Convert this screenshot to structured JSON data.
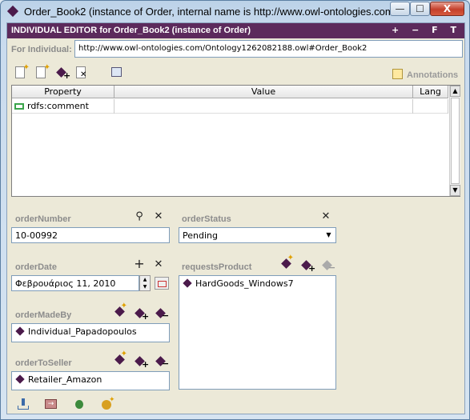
{
  "window": {
    "title": "Order_Book2   (instance of Order, internal name is http://www.owl-ontologies.com/",
    "min_label": "—",
    "max_label": "☐",
    "close_label": "X"
  },
  "editor": {
    "header_label": "INDIVIDUAL EDITOR for Order_Book2   (instance of Order)",
    "header_actions": "+ − F T",
    "for_individual_label": "For Individual:",
    "for_individual_value": "http://www.owl-ontologies.com/Ontology1262082188.owl#Order_Book2",
    "annotations_label": "Annotations"
  },
  "properties_table": {
    "columns": [
      "Property",
      "Value",
      "Lang"
    ],
    "rows": [
      {
        "property": "rdfs:comment",
        "value": "",
        "lang": ""
      }
    ]
  },
  "fields": {
    "order_number": {
      "label": "orderNumber",
      "value": "10-00992"
    },
    "order_status": {
      "label": "orderStatus",
      "value": "Pending"
    },
    "order_date": {
      "label": "orderDate",
      "value": "Φεβρουάριος 11, 2010"
    },
    "requests_product": {
      "label": "requestsProduct",
      "items": [
        "HardGoods_Windows7"
      ]
    },
    "order_made_by": {
      "label": "orderMadeBy",
      "value": "Individual_Papadopoulos"
    },
    "order_to_seller": {
      "label": "orderToSeller",
      "value": "Retailer_Amazon"
    }
  },
  "icons": {
    "toolbar": [
      "create-individual-icon",
      "create-value-icon",
      "add-instance-icon",
      "delete-instance-icon",
      "view-icon"
    ],
    "find": "magnifier-icon",
    "delete": "delete-x-icon",
    "add": "plus-icon",
    "footer": [
      "import-icon",
      "next-icon",
      "bug-icon",
      "sun-icon"
    ]
  },
  "colors": {
    "header_bg": "#5c2a5c",
    "instance_diamond": "#4b1a4b",
    "label_gray": "#8c8c8c"
  }
}
